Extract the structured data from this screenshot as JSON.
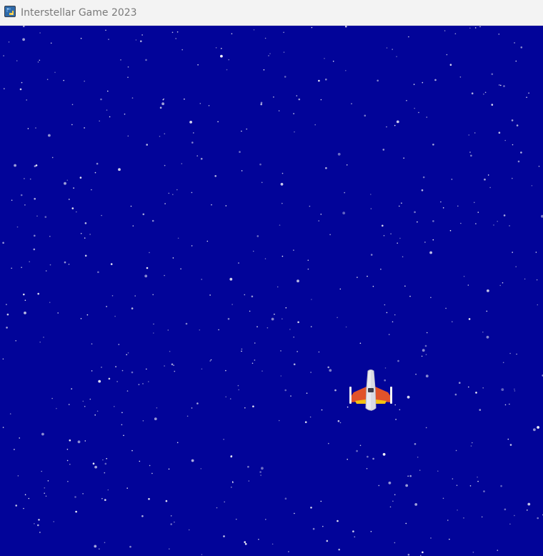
{
  "window": {
    "title": "Interstellar Game 2023",
    "icon": "python-icon"
  },
  "game": {
    "background_color": "#020499",
    "star_color": "#ffffff",
    "player": {
      "sprite": "spaceship-icon",
      "hull_color": "#e9e9ef",
      "wing_color": "#e1532a",
      "engine_color": "#f5c211"
    }
  }
}
